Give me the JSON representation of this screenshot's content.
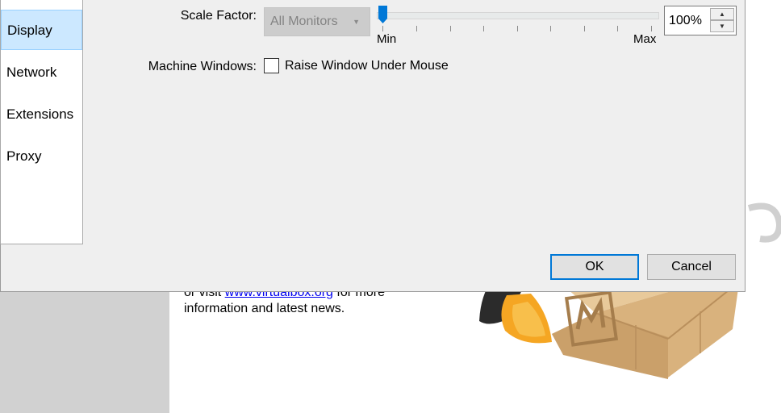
{
  "background": {
    "welcome_line1_prefix": "or visit ",
    "welcome_link": "www.virtualbox.org",
    "welcome_line1_suffix": " for more",
    "welcome_line2": "information and latest news."
  },
  "settings_nav": {
    "items": [
      {
        "label": "Display",
        "selected": true
      },
      {
        "label": "Network",
        "selected": false
      },
      {
        "label": "Extensions",
        "selected": false
      },
      {
        "label": "Proxy",
        "selected": false
      }
    ]
  },
  "display": {
    "scale_factor_label": "Scale Factor:",
    "monitor_select_value": "All Monitors",
    "slider_min_label": "Min",
    "slider_max_label": "Max",
    "slider_value_fraction": 0,
    "scale_value": "100%",
    "machine_windows_label": "Machine Windows:",
    "raise_window_label": "Raise Window Under Mouse",
    "raise_window_checked": false
  },
  "buttons": {
    "ok_label": "OK",
    "cancel_label": "Cancel"
  },
  "colors": {
    "accent": "#0078d7",
    "nav_selected": "#cce8ff"
  }
}
